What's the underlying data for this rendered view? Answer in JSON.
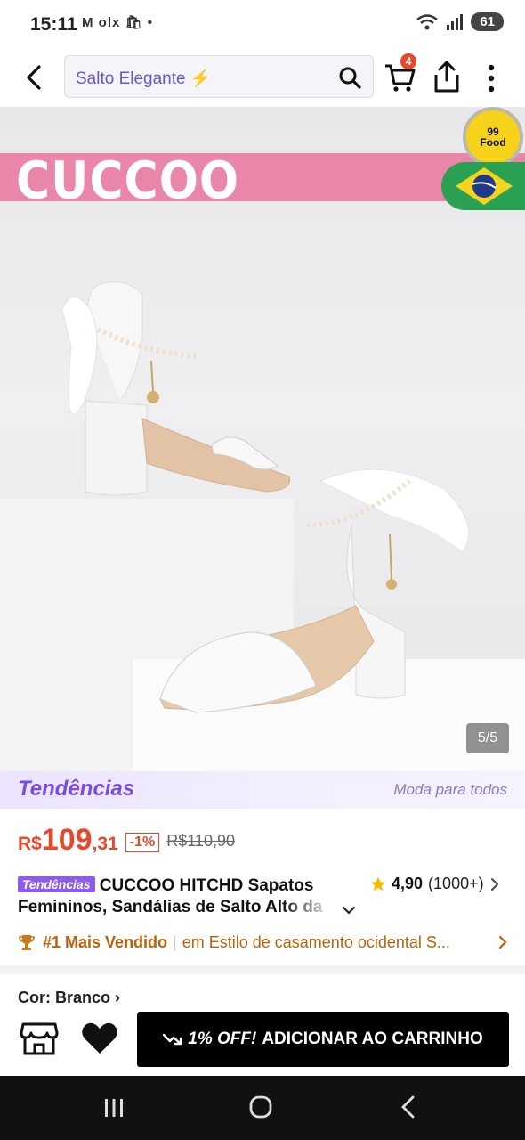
{
  "status_bar": {
    "time": "15:11",
    "notifications": "M olx 🛍 •",
    "battery": "61"
  },
  "header": {
    "search_value": "Salto Elegante",
    "cart_count": "4"
  },
  "gallery": {
    "brand_banner": "CUCCOO",
    "food_badge_line1": "99",
    "food_badge_line2": "Food",
    "page_indicator": "5/5"
  },
  "trend_banner": {
    "logo": "Tendências",
    "slogan": "Moda para todos"
  },
  "price": {
    "currency": "R$",
    "integer": "109",
    "decimal": ",31",
    "discount": "-1%",
    "original": "R$110,90"
  },
  "product": {
    "tag": "Tendências",
    "title_line1": "CUCCOO HITCHD Sapatos",
    "title_line2": "Femininos, Sandálias de Salto Alto da",
    "rating": "4,90",
    "rating_count": "(1000+)"
  },
  "bestseller": {
    "rank": "#1 Mais Vendido",
    "separator": "|",
    "category": "em Estilo de casamento ocidental S..."
  },
  "variant": {
    "color_label": "Cor: Branco"
  },
  "action_bar": {
    "cta_discount": "1% OFF!",
    "cta_label": "ADICIONAR AO CARRINHO"
  },
  "colors": {
    "accent": "#e5482a",
    "brand_purple": "#7a4be2",
    "banner_pink": "#ea86aa",
    "bestseller_orange": "#b8620d"
  }
}
